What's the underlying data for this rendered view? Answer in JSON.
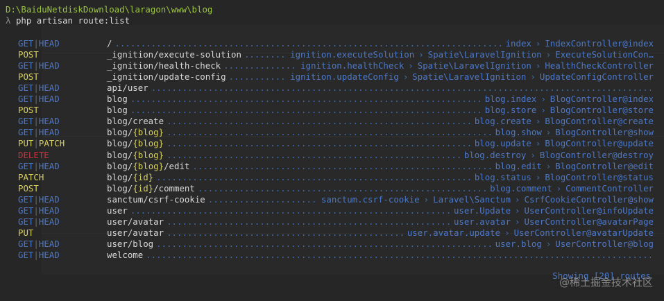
{
  "prompt": {
    "path": "D:\\BaiduNetdiskDownload\\laragon\\www\\blog",
    "symbol": "λ",
    "command": "php artisan route:list"
  },
  "routes": [
    {
      "methods": [
        "GET",
        "HEAD"
      ],
      "uri": "/",
      "name": "index",
      "action": "IndexController@index"
    },
    {
      "methods": [
        "POST"
      ],
      "uri": "_ignition/execute-solution",
      "name": "ignition.executeSolution",
      "middleware": "Spatie\\LaravelIgnition",
      "action": "ExecuteSolutionCon…"
    },
    {
      "methods": [
        "GET",
        "HEAD"
      ],
      "uri": "_ignition/health-check",
      "name": "ignition.healthCheck",
      "middleware": "Spatie\\LaravelIgnition",
      "action": "HealthCheckController"
    },
    {
      "methods": [
        "POST"
      ],
      "uri": "_ignition/update-config",
      "name": "ignition.updateConfig",
      "middleware": "Spatie\\LaravelIgnition",
      "action": "UpdateConfigController"
    },
    {
      "methods": [
        "GET",
        "HEAD"
      ],
      "uri": "api/user",
      "name": "",
      "action": ""
    },
    {
      "methods": [
        "GET",
        "HEAD"
      ],
      "uri": "blog",
      "name": "blog.index",
      "action": "BlogController@index"
    },
    {
      "methods": [
        "POST"
      ],
      "uri": "blog",
      "name": "blog.store",
      "action": "BlogController@store"
    },
    {
      "methods": [
        "GET",
        "HEAD"
      ],
      "uri": "blog/create",
      "name": "blog.create",
      "action": "BlogController@create"
    },
    {
      "methods": [
        "GET",
        "HEAD"
      ],
      "uri_parts": [
        "blog/",
        "{blog}"
      ],
      "name": "blog.show",
      "action": "BlogController@show"
    },
    {
      "methods": [
        "PUT",
        "PATCH"
      ],
      "uri_parts": [
        "blog/",
        "{blog}"
      ],
      "name": "blog.update",
      "action": "BlogController@update"
    },
    {
      "methods": [
        "DELETE"
      ],
      "uri_parts": [
        "blog/",
        "{blog}"
      ],
      "name": "blog.destroy",
      "action": "BlogController@destroy"
    },
    {
      "methods": [
        "GET",
        "HEAD"
      ],
      "uri_parts": [
        "blog/",
        "{blog}",
        "/edit"
      ],
      "name": "blog.edit",
      "action": "BlogController@edit"
    },
    {
      "methods": [
        "PATCH"
      ],
      "uri_parts": [
        "blog/",
        "{id}"
      ],
      "name": "blog.status",
      "action": "BlogController@status"
    },
    {
      "methods": [
        "POST"
      ],
      "uri_parts": [
        "blog/",
        "{id}",
        "/comment"
      ],
      "name": "blog.comment",
      "action": "CommentController"
    },
    {
      "methods": [
        "GET",
        "HEAD"
      ],
      "uri": "sanctum/csrf-cookie",
      "name": "sanctum.csrf-cookie",
      "middleware": "Laravel\\Sanctum",
      "action": "CsrfCookieController@show"
    },
    {
      "methods": [
        "GET",
        "HEAD"
      ],
      "uri": "user",
      "name": "user.Update",
      "action": "UserController@infoUpdate"
    },
    {
      "methods": [
        "GET",
        "HEAD"
      ],
      "uri": "user/avatar",
      "name": "user.avatar",
      "action": "UserController@avatarPage"
    },
    {
      "methods": [
        "PUT"
      ],
      "uri": "user/avatar",
      "name": "user.avatar.update",
      "action": "UserController@avatarUpdate"
    },
    {
      "methods": [
        "GET",
        "HEAD"
      ],
      "uri": "user/blog",
      "name": "user.blog",
      "action": "UserController@blog"
    },
    {
      "methods": [
        "GET",
        "HEAD"
      ],
      "uri": "welcome",
      "name": "",
      "action": ""
    }
  ],
  "footer": {
    "showing": "Showing [20] routes"
  },
  "watermark": "@稀土掘金技术社区"
}
